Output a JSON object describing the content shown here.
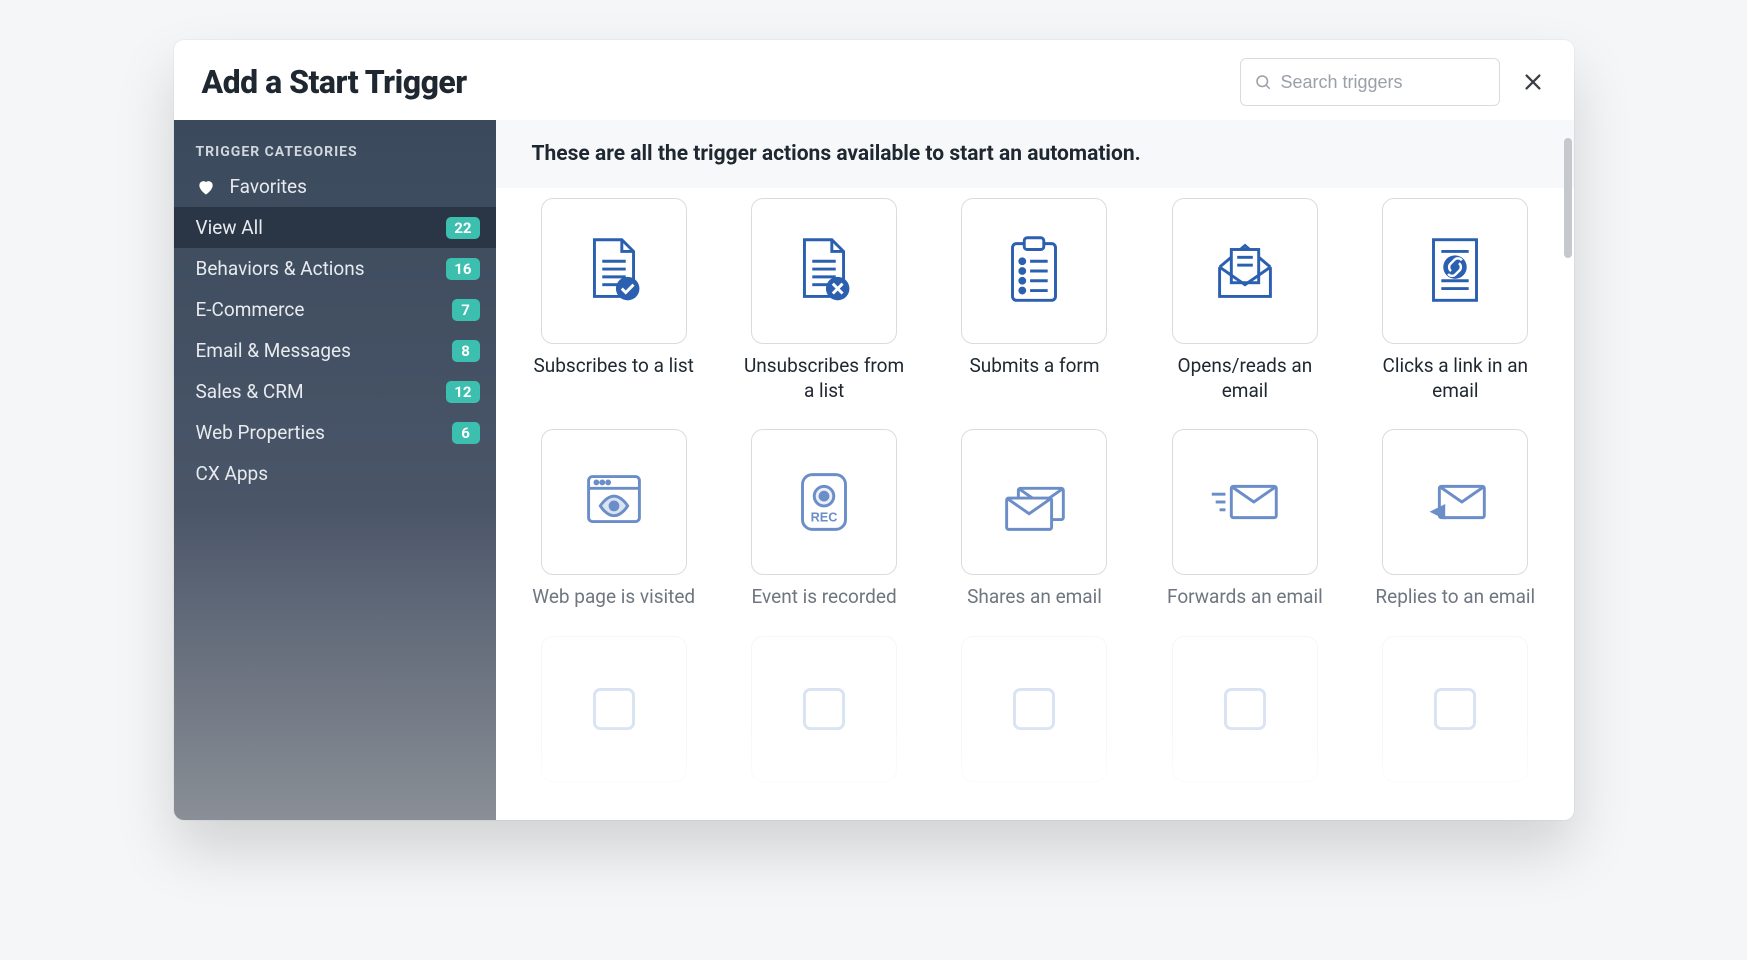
{
  "header": {
    "title": "Add a Start Trigger",
    "search_placeholder": "Search triggers"
  },
  "sidebar": {
    "heading": "TRIGGER CATEGORIES",
    "items": [
      {
        "icon": "heart",
        "label": "Favorites",
        "count": null,
        "active": false
      },
      {
        "icon": null,
        "label": "View All",
        "count": 22,
        "active": true
      },
      {
        "icon": null,
        "label": "Behaviors & Actions",
        "count": 16,
        "active": false
      },
      {
        "icon": null,
        "label": "E-Commerce",
        "count": 7,
        "active": false
      },
      {
        "icon": null,
        "label": "Email & Messages",
        "count": 8,
        "active": false
      },
      {
        "icon": null,
        "label": "Sales & CRM",
        "count": 12,
        "active": false
      },
      {
        "icon": null,
        "label": "Web Properties",
        "count": 6,
        "active": false
      },
      {
        "icon": null,
        "label": "CX Apps",
        "count": null,
        "active": false
      }
    ]
  },
  "content": {
    "description": "These are all the trigger actions available to start an automation.",
    "triggers": [
      {
        "id": "subscribes-list",
        "label": "Subscribes to a list",
        "icon": "doc-check",
        "muted": false
      },
      {
        "id": "unsubscribes-list",
        "label": "Unsubscribes from a list",
        "icon": "doc-x",
        "muted": false
      },
      {
        "id": "submits-form",
        "label": "Submits a form",
        "icon": "clipboard",
        "muted": false
      },
      {
        "id": "opens-email",
        "label": "Opens/reads an email",
        "icon": "mail-open",
        "muted": false
      },
      {
        "id": "clicks-link-email",
        "label": "Clicks a link in an email",
        "icon": "doc-link",
        "muted": false
      },
      {
        "id": "web-page-visited",
        "label": "Web page is visited",
        "icon": "browser-eye",
        "muted": true
      },
      {
        "id": "event-recorded",
        "label": "Event is recorded",
        "icon": "rec",
        "muted": true
      },
      {
        "id": "shares-email",
        "label": "Shares an email",
        "icon": "mail-share",
        "muted": true
      },
      {
        "id": "forwards-email",
        "label": "Forwards an email",
        "icon": "mail-forward",
        "muted": true
      },
      {
        "id": "replies-email",
        "label": "Replies to an email",
        "icon": "mail-reply",
        "muted": true
      }
    ]
  }
}
